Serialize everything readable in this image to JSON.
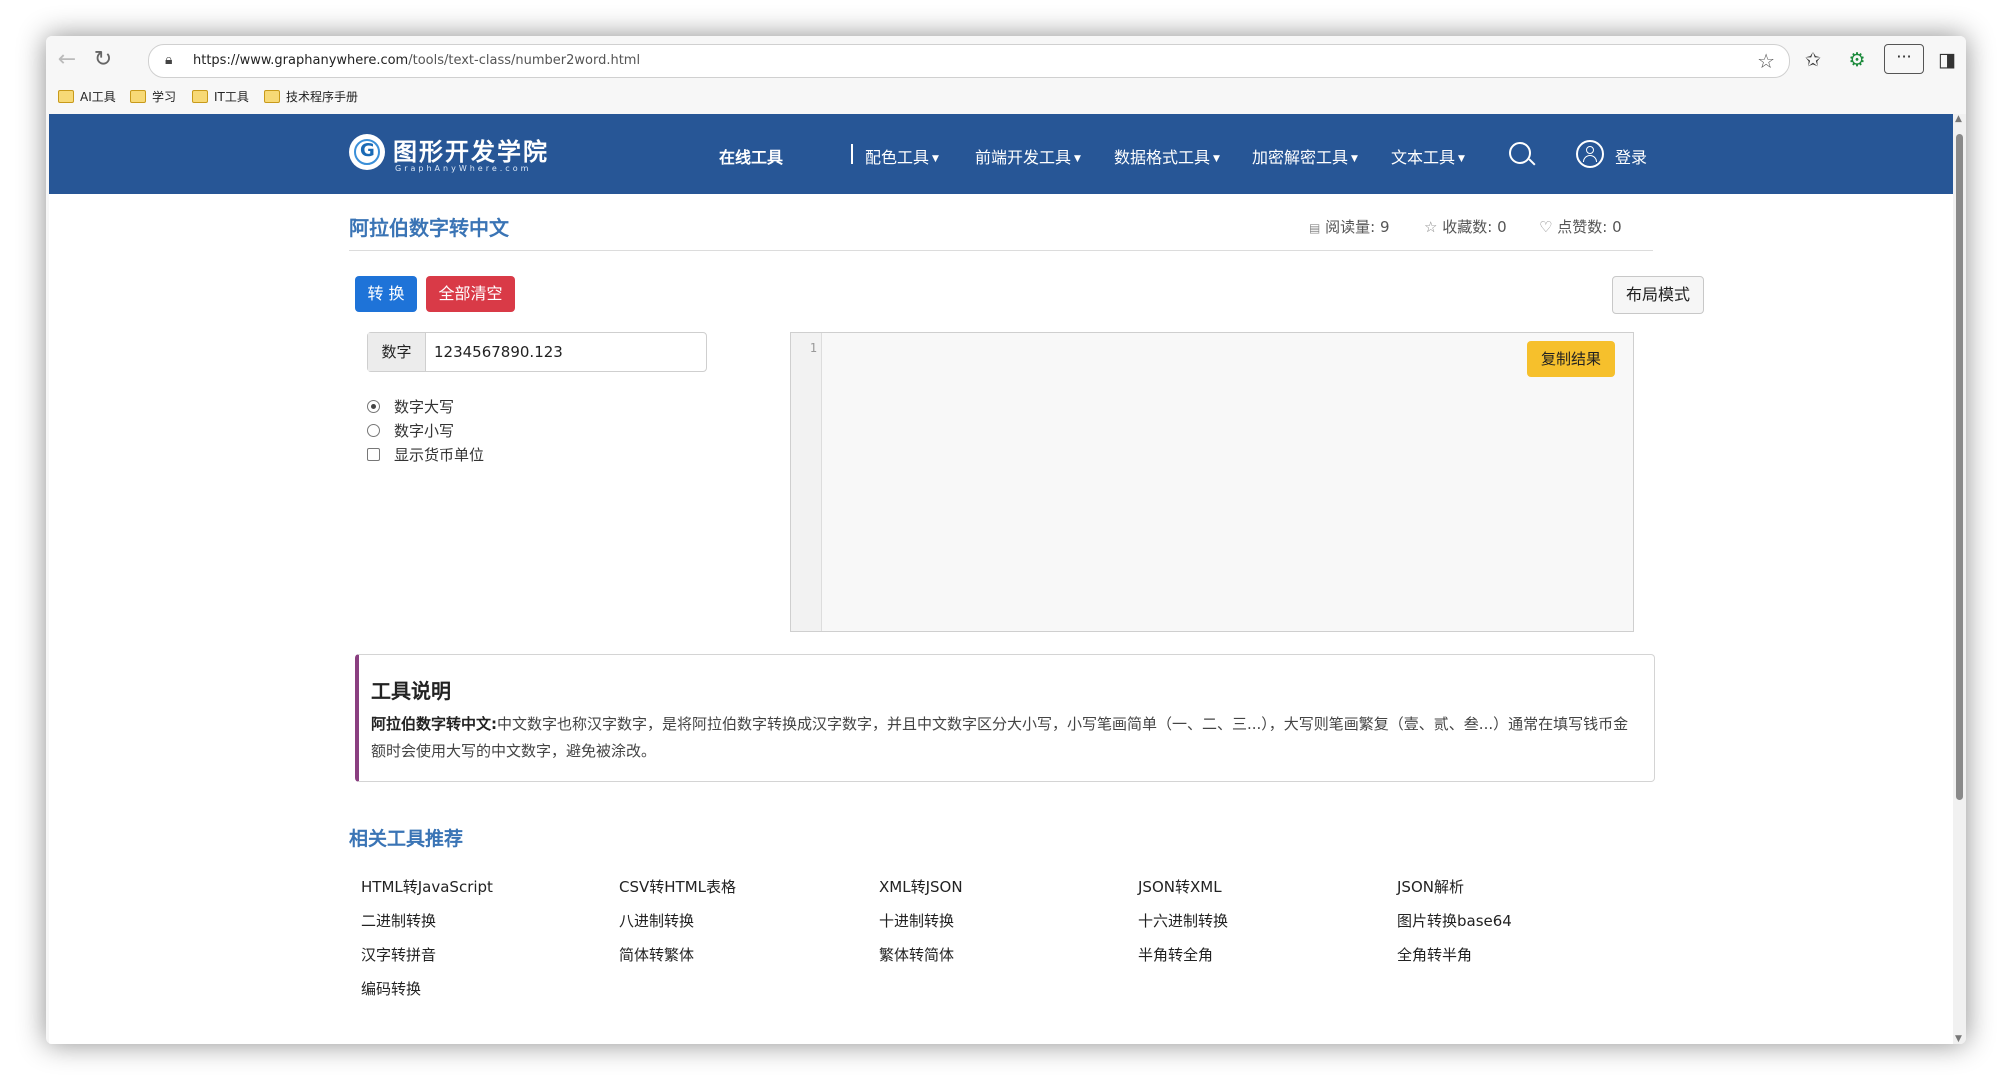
{
  "browser": {
    "url_host": "https://www.graphanywhere.com",
    "url_path": "/tools/text-class/number2word.html",
    "bookmarks": [
      "AI工具",
      "学习",
      "IT工具",
      "技术程序手册"
    ]
  },
  "site": {
    "logo_title": "图形开发学院",
    "logo_subtitle": "GraphAnyWhere.com",
    "nav": {
      "online_tools": "在线工具",
      "color_tools": "配色工具",
      "frontend_tools": "前端开发工具",
      "data_format_tools": "数据格式工具",
      "crypto_tools": "加密解密工具",
      "text_tools": "文本工具",
      "login": "登录"
    }
  },
  "page": {
    "title": "阿拉伯数字转中文",
    "stats": {
      "reads_label": "阅读量:",
      "reads": "9",
      "favs_label": "收藏数:",
      "favs": "0",
      "likes_label": "点赞数:",
      "likes": "0"
    },
    "buttons": {
      "convert": "转 换",
      "clear_all": "全部清空",
      "layout_mode": "布局模式",
      "copy_result": "复制结果"
    },
    "input": {
      "addon": "数字",
      "value": "1234567890.123"
    },
    "options": {
      "upper": "数字大写",
      "lower": "数字小写",
      "currency": "显示货币单位"
    },
    "editor": {
      "line_number": "1"
    },
    "info": {
      "heading": "工具说明",
      "term": "阿拉伯数字转中文:",
      "text": "中文数字也称汉字数字，是将阿拉伯数字转换成汉字数字，并且中文数字区分大小写，小写笔画简单（一、二、三...），大写则笔画繁复（壹、贰、叁...）通常在填写钱币金额时会使用大写的中文数字，避免被涂改。"
    },
    "related": {
      "heading": "相关工具推荐",
      "links": [
        "HTML转JavaScript",
        "CSV转HTML表格",
        "XML转JSON",
        "JSON转XML",
        "JSON解析",
        "二进制转换",
        "八进制转换",
        "十进制转换",
        "十六进制转换",
        "图片转换base64",
        "汉字转拼音",
        "简体转繁体",
        "繁体转简体",
        "半角转全角",
        "全角转半角",
        "编码转换"
      ]
    }
  }
}
